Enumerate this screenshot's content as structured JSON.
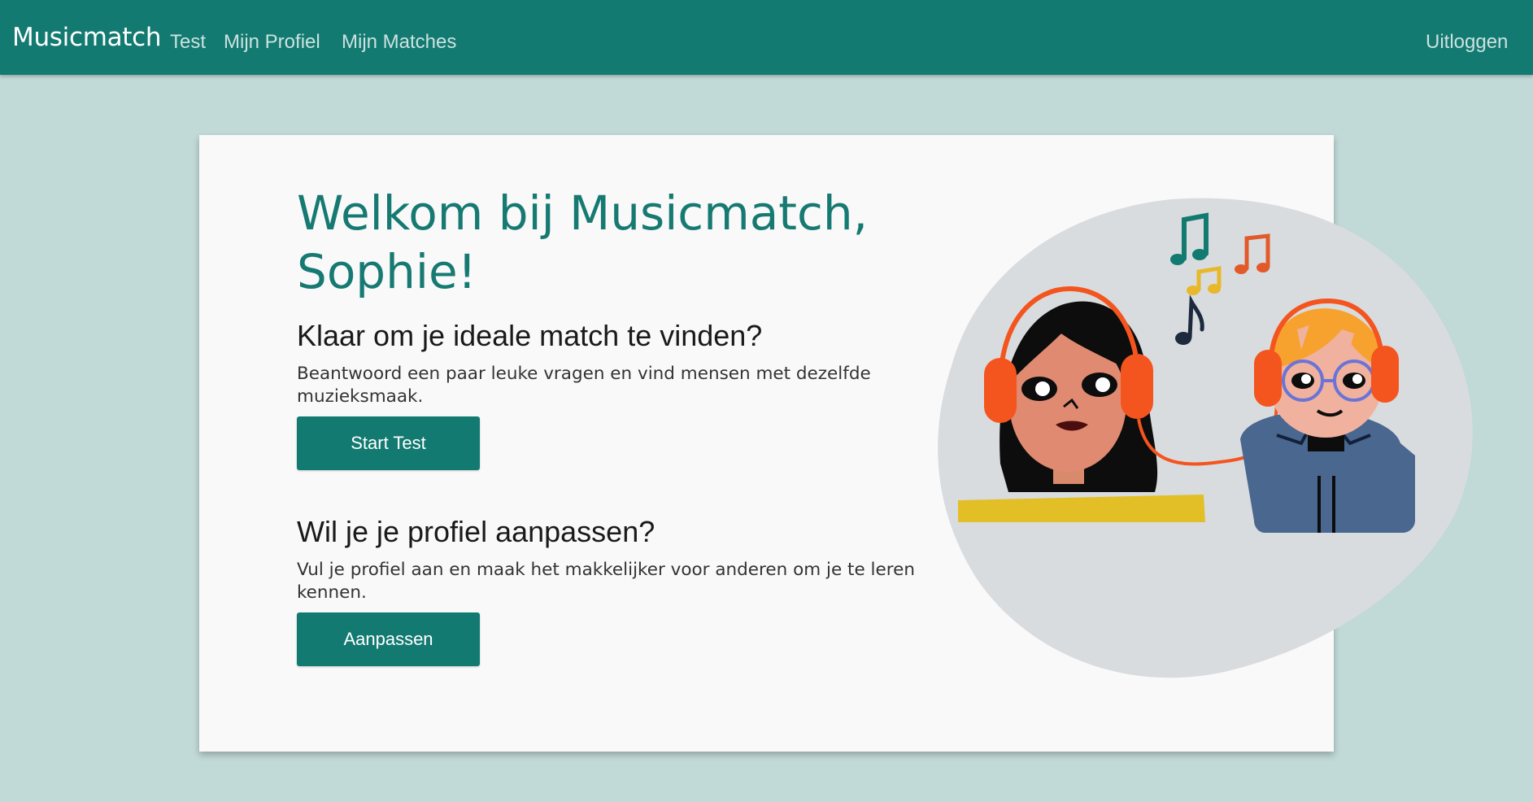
{
  "navbar": {
    "brand": "Musicmatch",
    "links": [
      "Test",
      "Mijn Profiel",
      "Mijn Matches"
    ],
    "logout": "Uitloggen",
    "color": "#137a71"
  },
  "main": {
    "welcome": "Welkom bij Musicmatch, Sophie!",
    "test_section": {
      "title": "Klaar om je ideale match te vinden?",
      "text": "Beantwoord een paar leuke vragen en vind mensen met dezelfde muzieksmaak.",
      "button": "Start Test"
    },
    "profile_section": {
      "title": "Wil je je profiel aanpassen?",
      "text": "Vul je profiel aan en maak het makkelijker voor anderen om je te leren kennen.",
      "button": "Aanpassen"
    }
  },
  "illustration": {
    "icons": [
      "music-note-icon",
      "headphones-icon"
    ],
    "colors": {
      "blob": "#d8dcdf",
      "headphones": "#f4551e",
      "shirt_left": "#e3bf27",
      "hoodie_right": "#4a6790"
    }
  }
}
